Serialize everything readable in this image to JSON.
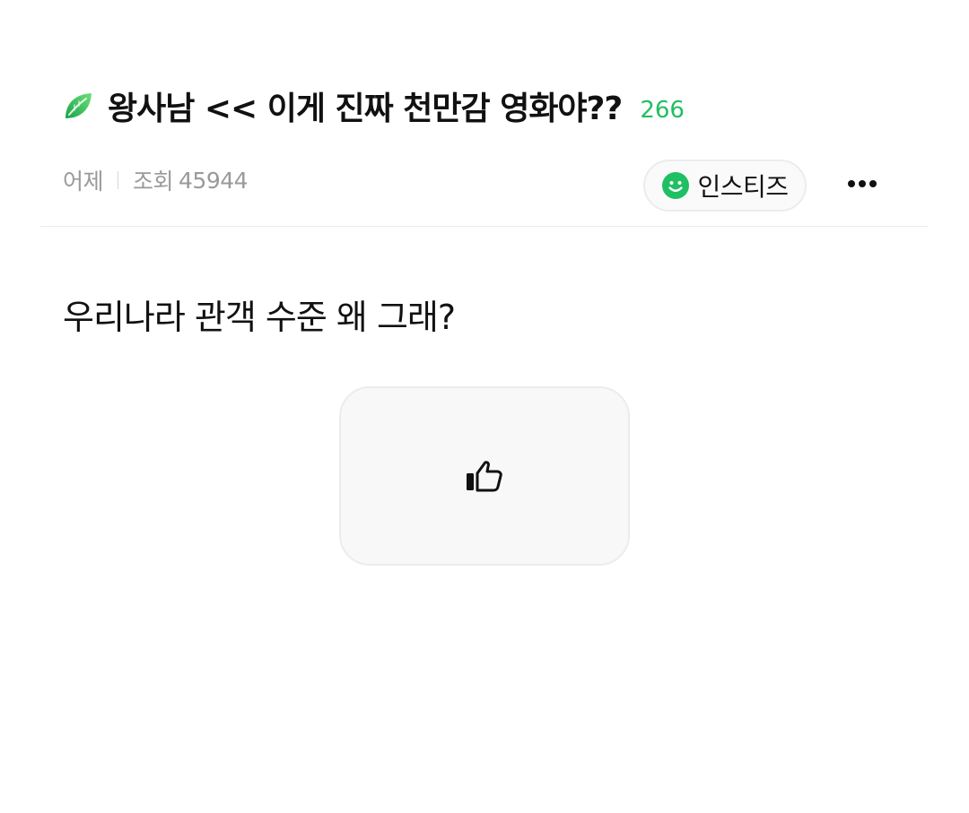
{
  "post": {
    "title": "왕사남 << 이게 진짜 천만감 영화야??",
    "comment_count": "266",
    "date": "어제",
    "views_label": "조회",
    "views": "45944",
    "board_name": "인스티즈",
    "body": "우리나라 관객 수준 왜 그래?"
  },
  "icons": {
    "leaf": "leaf-icon",
    "smile": "smile-icon",
    "more": "more-horizontal-icon",
    "thumb": "thumbs-up-icon"
  },
  "colors": {
    "accent_green": "#1fbf63",
    "leaf_green": "#2fc25c",
    "meta_gray": "#9a9a9a"
  }
}
